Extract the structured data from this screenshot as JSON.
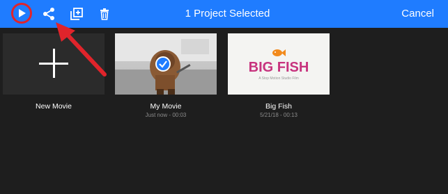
{
  "toolbar": {
    "title": "1 Project Selected",
    "cancel_label": "Cancel",
    "icons": [
      "play-icon",
      "share-icon",
      "duplicate-icon",
      "trash-icon"
    ]
  },
  "colors": {
    "toolbar_bg": "#1f7cff",
    "background": "#1e1e1e",
    "highlight_red": "#e0242b",
    "check_blue": "#1f7cff"
  },
  "projects": [
    {
      "title": "New Movie",
      "subtitle": ""
    },
    {
      "title": "My Movie",
      "subtitle": "Just now - 00:03",
      "selected": true
    },
    {
      "title": "Big Fish",
      "subtitle": "5/21/18 - 00:13",
      "logo_text": "BIG FISH",
      "logo_sub": "A Stop Motion Studio Film"
    }
  ]
}
